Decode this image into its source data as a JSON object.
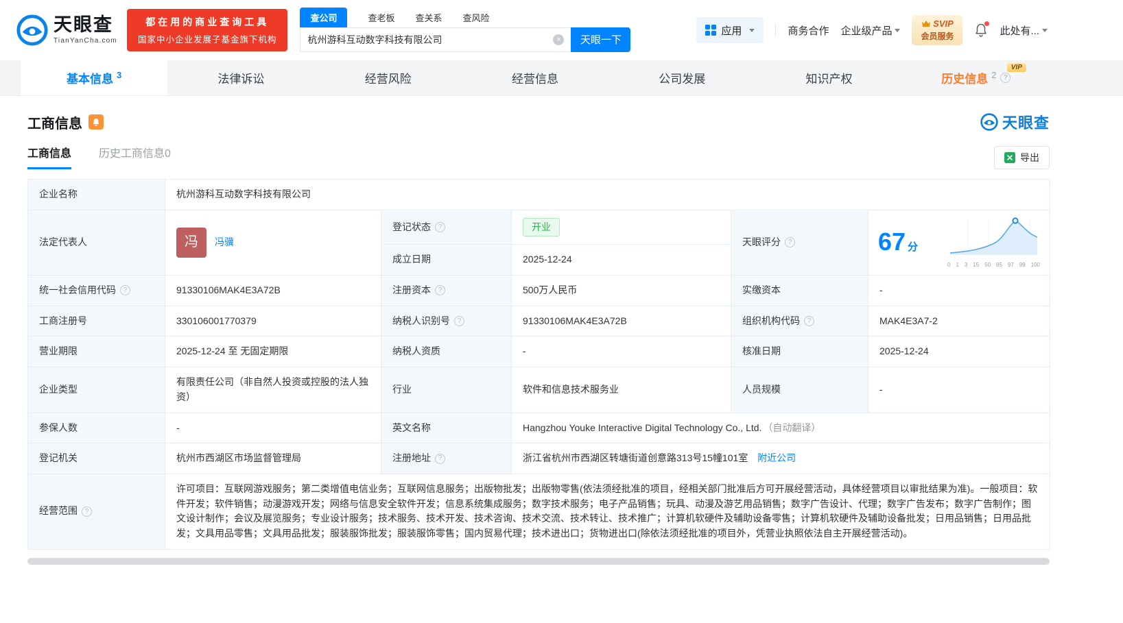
{
  "colors": {
    "brand_blue": "#0084ff",
    "promo_red": "#ee3b28",
    "history_orange": "#ff7d2e",
    "status_green": "#2cb54c",
    "label_bg": "#f3f8fd"
  },
  "header": {
    "logo": {
      "brand": "天眼查",
      "domain": "TianYanCha.com"
    },
    "promo": {
      "line1": "都在用的商业查询工具",
      "line2": "国家中小企业发展子基金旗下机构"
    },
    "search": {
      "tabs": [
        "查公司",
        "查老板",
        "查关系",
        "查风险"
      ],
      "value": "杭州游科互动数字科技有限公司",
      "button": "天眼一下"
    },
    "nav": {
      "apps": "应用",
      "cooperation": "商务合作",
      "enterprise": "企业级产品",
      "svip_top": "SVIP",
      "svip_bottom": "会员服务",
      "more": "此处有..."
    }
  },
  "tabs": {
    "basic": {
      "label": "基本信息",
      "count": "3"
    },
    "legal": {
      "label": "法律诉讼"
    },
    "risk": {
      "label": "经营风险"
    },
    "operation": {
      "label": "经营信息"
    },
    "development": {
      "label": "公司发展"
    },
    "ip": {
      "label": "知识产权"
    },
    "history": {
      "label": "历史信息",
      "count": "2",
      "vip": "VIP"
    }
  },
  "section": {
    "title": "工商信息",
    "watermark": "天眼查",
    "subtab_active": "工商信息",
    "subtab_history": "历史工商信息0",
    "export": "导出"
  },
  "info": {
    "company_name": {
      "label": "企业名称",
      "value": "杭州游科互动数字科技有限公司"
    },
    "legal_rep": {
      "label": "法定代表人",
      "avatar": "冯",
      "name": "冯骥"
    },
    "reg_status": {
      "label": "登记状态",
      "value": "开业"
    },
    "establish_date": {
      "label": "成立日期",
      "value": "2025-12-24"
    },
    "score": {
      "label": "天眼评分",
      "value": "67",
      "unit": "分",
      "ticks": [
        "0",
        "1",
        "3",
        "15",
        "50",
        "85",
        "97",
        "99",
        "100"
      ]
    },
    "credit_code": {
      "label": "统一社会信用代码",
      "value": "91330106MAK4E3A72B"
    },
    "reg_capital": {
      "label": "注册资本",
      "value": "500万人民币"
    },
    "paid_capital": {
      "label": "实缴资本",
      "value": "-"
    },
    "reg_no": {
      "label": "工商注册号",
      "value": "330106001770379"
    },
    "taxpayer_id": {
      "label": "纳税人识别号",
      "value": "91330106MAK4E3A72B"
    },
    "org_code": {
      "label": "组织机构代码",
      "value": "MAK4E3A7-2"
    },
    "business_term": {
      "label": "营业期限",
      "value": "2025-12-24 至 无固定期限"
    },
    "taxpayer_qualification": {
      "label": "纳税人资质",
      "value": "-"
    },
    "approval_date": {
      "label": "核准日期",
      "value": "2025-12-24"
    },
    "company_type": {
      "label": "企业类型",
      "value": "有限责任公司（非自然人投资或控股的法人独资）"
    },
    "industry": {
      "label": "行业",
      "value": "软件和信息技术服务业"
    },
    "staff_size": {
      "label": "人员规模",
      "value": "-"
    },
    "insured_count": {
      "label": "参保人数",
      "value": "-"
    },
    "english_name": {
      "label": "英文名称",
      "value": "Hangzhou Youke Interactive Digital Technology Co., Ltd.",
      "note": "（自动翻译）"
    },
    "reg_authority": {
      "label": "登记机关",
      "value": "杭州市西湖区市场监督管理局"
    },
    "reg_address": {
      "label": "注册地址",
      "value": "浙江省杭州市西湖区转塘街道创意路313号15幢101室",
      "link": "附近公司"
    },
    "business_scope": {
      "label": "经营范围",
      "value": "许可项目：互联网游戏服务；第二类增值电信业务；互联网信息服务；出版物批发；出版物零售(依法须经批准的项目，经相关部门批准后方可开展经营活动，具体经营项目以审批结果为准)。一般项目：软件开发；软件销售；动漫游戏开发；网络与信息安全软件开发；信息系统集成服务；数字技术服务；电子产品销售；玩具、动漫及游艺用品销售；数字广告设计、代理；数字广告发布；数字广告制作；图文设计制作；会议及展览服务；专业设计服务；技术服务、技术开发、技术咨询、技术交流、技术转让、技术推广；计算机软硬件及辅助设备零售；计算机软硬件及辅助设备批发；日用品销售；日用品批发；文具用品零售；文具用品批发；服装服饰批发；服装服饰零售；国内贸易代理；技术进出口；货物进出口(除依法须经批准的项目外，凭营业执照依法自主开展经营活动)。"
    }
  }
}
